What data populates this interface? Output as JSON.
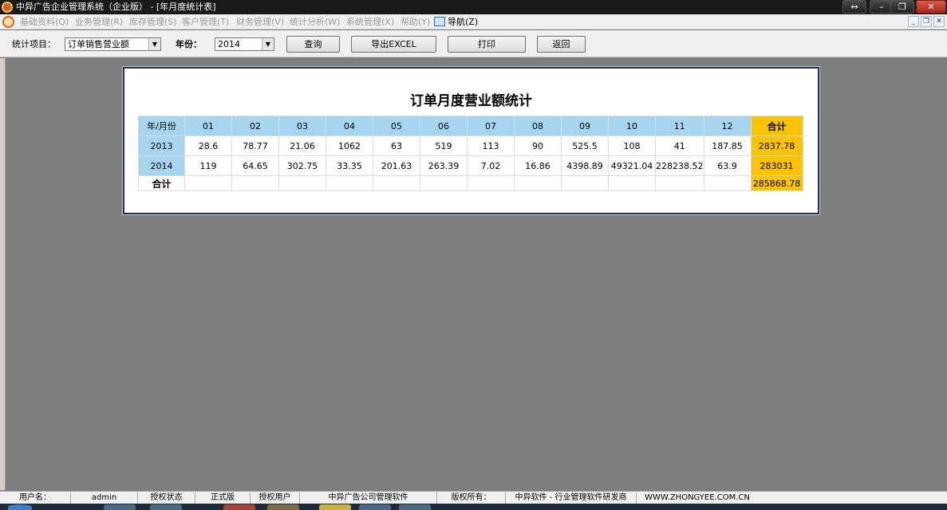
{
  "window": {
    "title": "中异广告企业管理系统（企业版） - [年月度统计表]"
  },
  "menu": {
    "items": [
      {
        "label": "基础资料(Q)",
        "active": false
      },
      {
        "label": "业务管理(R)",
        "active": false
      },
      {
        "label": "库存管理(S)",
        "active": false
      },
      {
        "label": "客户管理(T)",
        "active": false
      },
      {
        "label": "财务管理(V)",
        "active": false
      },
      {
        "label": "统计分析(W)",
        "active": false
      },
      {
        "label": "系统管理(X)",
        "active": false
      },
      {
        "label": "帮助(Y)",
        "active": false
      }
    ],
    "nav_label": "导航(Z)"
  },
  "toolbar": {
    "stat_item_label": "统计项目：",
    "stat_item_value": "订单销售营业额",
    "year_label": "年份：",
    "year_value": "2014",
    "query_label": "查询",
    "export_label": "导出EXCEL",
    "print_label": "打印",
    "back_label": "返回"
  },
  "report": {
    "title": "订单月度营业额统计",
    "corner_header": "年/月份",
    "months": [
      "01",
      "02",
      "03",
      "04",
      "05",
      "06",
      "07",
      "08",
      "09",
      "10",
      "11",
      "12"
    ],
    "total_header": "合计",
    "rows": [
      {
        "year": "2013",
        "values": [
          "28.6",
          "78.77",
          "21.06",
          "1062",
          "63",
          "519",
          "113",
          "90",
          "525.5",
          "108",
          "41",
          "187.85"
        ],
        "total": "2837.78"
      },
      {
        "year": "2014",
        "values": [
          "119",
          "64.65",
          "302.75",
          "33.35",
          "201.63",
          "263.39",
          "7.02",
          "16.86",
          "4398.89",
          "49321.04",
          "228238.52",
          "63.9"
        ],
        "total": "283031"
      }
    ],
    "grand_total_label": "合计",
    "grand_total": "285868.78"
  },
  "status": {
    "user_label": "用户名：",
    "user_value": "admin",
    "auth_status_label": "授权状态",
    "auth_status_value": "正式版",
    "auth_user_label": "授权用户",
    "auth_user_value": "中异广告公司管理软件",
    "copyright_label": "版权所有：",
    "copyright_value": "中异软件 - 行业管理软件研发商",
    "website": "WWW.ZHONGYEE.COM.CN"
  },
  "colors": {
    "header_blue": "#a6d6ef",
    "total_gold": "#f9c300",
    "panel_border": "#1f2f5a",
    "workspace_gray": "#7f7f7f"
  }
}
